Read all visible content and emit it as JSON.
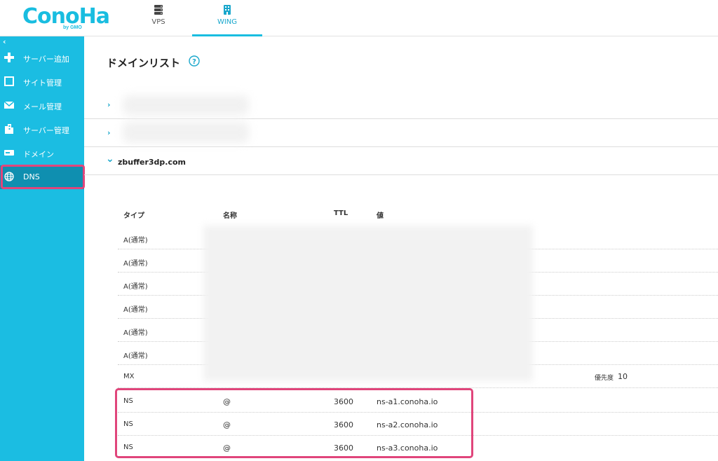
{
  "brand": {
    "name": "ConoHa",
    "sub": "by GMO"
  },
  "nav": {
    "tabs": [
      {
        "label": "VPS",
        "icon": "server-stack-icon"
      },
      {
        "label": "WING",
        "icon": "wing-building-icon",
        "active": true
      }
    ]
  },
  "sidebar": {
    "collapse_glyph": "‹",
    "items": [
      {
        "label": "サーバー追加",
        "icon": "plus-icon"
      },
      {
        "label": "サイト管理",
        "icon": "window-icon"
      },
      {
        "label": "メール管理",
        "icon": "mail-icon"
      },
      {
        "label": "サーバー管理",
        "icon": "server-manage-icon"
      },
      {
        "label": "ドメイン",
        "icon": "domain-icon"
      },
      {
        "label": "DNS",
        "icon": "globe-icon",
        "active": true
      }
    ]
  },
  "main": {
    "title": "ドメインリスト",
    "help_glyph": "?",
    "domains": [
      {
        "name": "",
        "expanded": false,
        "chevron": "›"
      },
      {
        "name": "",
        "expanded": false,
        "chevron": "›"
      },
      {
        "name": "zbuffer3dp.com",
        "expanded": true,
        "chevron": "⌄"
      }
    ],
    "table": {
      "headers": {
        "type": "タイプ",
        "name": "名称",
        "ttl": "TTL",
        "value": "値"
      },
      "rows": [
        {
          "type": "A(通常)",
          "name": "",
          "ttl": "",
          "value": ""
        },
        {
          "type": "A(通常)",
          "name": "",
          "ttl": "",
          "value": ""
        },
        {
          "type": "A(通常)",
          "name": "",
          "ttl": "",
          "value": ""
        },
        {
          "type": "A(通常)",
          "name": "",
          "ttl": "",
          "value": ""
        },
        {
          "type": "A(通常)",
          "name": "",
          "ttl": "",
          "value": ""
        },
        {
          "type": "A(通常)",
          "name": "",
          "ttl": "",
          "value": ""
        },
        {
          "type": "MX",
          "name": "",
          "ttl": "",
          "value": "",
          "priority_label": "優先度",
          "priority": "10"
        },
        {
          "type": "NS",
          "name": "@",
          "ttl": "3600",
          "value": "ns-a1.conoha.io"
        },
        {
          "type": "NS",
          "name": "@",
          "ttl": "3600",
          "value": "ns-a2.conoha.io"
        },
        {
          "type": "NS",
          "name": "@",
          "ttl": "3600",
          "value": "ns-a3.conoha.io"
        }
      ]
    }
  },
  "colors": {
    "accent": "#1bbde2",
    "highlight": "#e0457b",
    "active_nav": "#0f8fb0"
  }
}
